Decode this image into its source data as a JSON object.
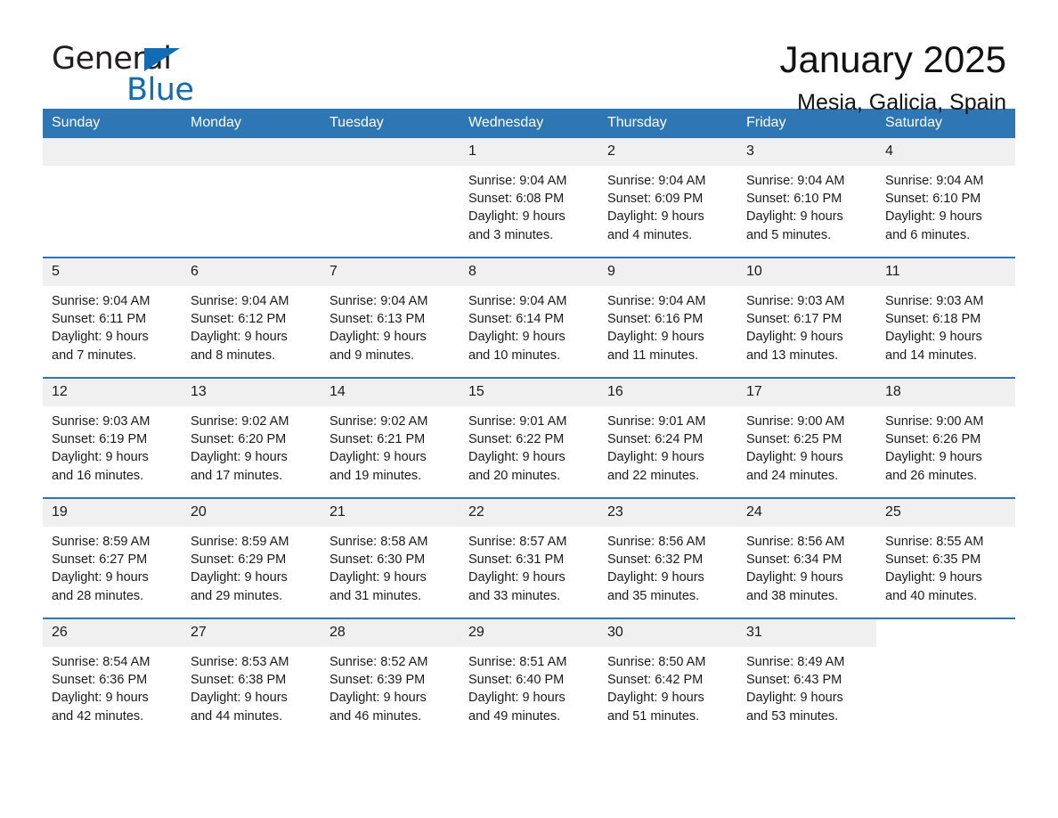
{
  "brand": {
    "name_part1": "General",
    "name_part2": "Blue",
    "triangle_color": "#0f6cb5"
  },
  "header": {
    "title": "January 2025",
    "subtitle": "Mesia, Galicia, Spain"
  },
  "colors": {
    "header_blue": "#2f76b4",
    "daynum_band": "#f0f0f0",
    "text": "#1a1a1a"
  },
  "weekday_headers": [
    "Sunday",
    "Monday",
    "Tuesday",
    "Wednesday",
    "Thursday",
    "Friday",
    "Saturday"
  ],
  "weeks": [
    [
      {
        "day": "",
        "empty": true
      },
      {
        "day": "",
        "empty": true
      },
      {
        "day": "",
        "empty": true
      },
      {
        "day": "1",
        "sunrise": "Sunrise: 9:04 AM",
        "sunset": "Sunset: 6:08 PM",
        "daylight1": "Daylight: 9 hours",
        "daylight2": "and 3 minutes."
      },
      {
        "day": "2",
        "sunrise": "Sunrise: 9:04 AM",
        "sunset": "Sunset: 6:09 PM",
        "daylight1": "Daylight: 9 hours",
        "daylight2": "and 4 minutes."
      },
      {
        "day": "3",
        "sunrise": "Sunrise: 9:04 AM",
        "sunset": "Sunset: 6:10 PM",
        "daylight1": "Daylight: 9 hours",
        "daylight2": "and 5 minutes."
      },
      {
        "day": "4",
        "sunrise": "Sunrise: 9:04 AM",
        "sunset": "Sunset: 6:10 PM",
        "daylight1": "Daylight: 9 hours",
        "daylight2": "and 6 minutes."
      }
    ],
    [
      {
        "day": "5",
        "sunrise": "Sunrise: 9:04 AM",
        "sunset": "Sunset: 6:11 PM",
        "daylight1": "Daylight: 9 hours",
        "daylight2": "and 7 minutes."
      },
      {
        "day": "6",
        "sunrise": "Sunrise: 9:04 AM",
        "sunset": "Sunset: 6:12 PM",
        "daylight1": "Daylight: 9 hours",
        "daylight2": "and 8 minutes."
      },
      {
        "day": "7",
        "sunrise": "Sunrise: 9:04 AM",
        "sunset": "Sunset: 6:13 PM",
        "daylight1": "Daylight: 9 hours",
        "daylight2": "and 9 minutes."
      },
      {
        "day": "8",
        "sunrise": "Sunrise: 9:04 AM",
        "sunset": "Sunset: 6:14 PM",
        "daylight1": "Daylight: 9 hours",
        "daylight2": "and 10 minutes."
      },
      {
        "day": "9",
        "sunrise": "Sunrise: 9:04 AM",
        "sunset": "Sunset: 6:16 PM",
        "daylight1": "Daylight: 9 hours",
        "daylight2": "and 11 minutes."
      },
      {
        "day": "10",
        "sunrise": "Sunrise: 9:03 AM",
        "sunset": "Sunset: 6:17 PM",
        "daylight1": "Daylight: 9 hours",
        "daylight2": "and 13 minutes."
      },
      {
        "day": "11",
        "sunrise": "Sunrise: 9:03 AM",
        "sunset": "Sunset: 6:18 PM",
        "daylight1": "Daylight: 9 hours",
        "daylight2": "and 14 minutes."
      }
    ],
    [
      {
        "day": "12",
        "sunrise": "Sunrise: 9:03 AM",
        "sunset": "Sunset: 6:19 PM",
        "daylight1": "Daylight: 9 hours",
        "daylight2": "and 16 minutes."
      },
      {
        "day": "13",
        "sunrise": "Sunrise: 9:02 AM",
        "sunset": "Sunset: 6:20 PM",
        "daylight1": "Daylight: 9 hours",
        "daylight2": "and 17 minutes."
      },
      {
        "day": "14",
        "sunrise": "Sunrise: 9:02 AM",
        "sunset": "Sunset: 6:21 PM",
        "daylight1": "Daylight: 9 hours",
        "daylight2": "and 19 minutes."
      },
      {
        "day": "15",
        "sunrise": "Sunrise: 9:01 AM",
        "sunset": "Sunset: 6:22 PM",
        "daylight1": "Daylight: 9 hours",
        "daylight2": "and 20 minutes."
      },
      {
        "day": "16",
        "sunrise": "Sunrise: 9:01 AM",
        "sunset": "Sunset: 6:24 PM",
        "daylight1": "Daylight: 9 hours",
        "daylight2": "and 22 minutes."
      },
      {
        "day": "17",
        "sunrise": "Sunrise: 9:00 AM",
        "sunset": "Sunset: 6:25 PM",
        "daylight1": "Daylight: 9 hours",
        "daylight2": "and 24 minutes."
      },
      {
        "day": "18",
        "sunrise": "Sunrise: 9:00 AM",
        "sunset": "Sunset: 6:26 PM",
        "daylight1": "Daylight: 9 hours",
        "daylight2": "and 26 minutes."
      }
    ],
    [
      {
        "day": "19",
        "sunrise": "Sunrise: 8:59 AM",
        "sunset": "Sunset: 6:27 PM",
        "daylight1": "Daylight: 9 hours",
        "daylight2": "and 28 minutes."
      },
      {
        "day": "20",
        "sunrise": "Sunrise: 8:59 AM",
        "sunset": "Sunset: 6:29 PM",
        "daylight1": "Daylight: 9 hours",
        "daylight2": "and 29 minutes."
      },
      {
        "day": "21",
        "sunrise": "Sunrise: 8:58 AM",
        "sunset": "Sunset: 6:30 PM",
        "daylight1": "Daylight: 9 hours",
        "daylight2": "and 31 minutes."
      },
      {
        "day": "22",
        "sunrise": "Sunrise: 8:57 AM",
        "sunset": "Sunset: 6:31 PM",
        "daylight1": "Daylight: 9 hours",
        "daylight2": "and 33 minutes."
      },
      {
        "day": "23",
        "sunrise": "Sunrise: 8:56 AM",
        "sunset": "Sunset: 6:32 PM",
        "daylight1": "Daylight: 9 hours",
        "daylight2": "and 35 minutes."
      },
      {
        "day": "24",
        "sunrise": "Sunrise: 8:56 AM",
        "sunset": "Sunset: 6:34 PM",
        "daylight1": "Daylight: 9 hours",
        "daylight2": "and 38 minutes."
      },
      {
        "day": "25",
        "sunrise": "Sunrise: 8:55 AM",
        "sunset": "Sunset: 6:35 PM",
        "daylight1": "Daylight: 9 hours",
        "daylight2": "and 40 minutes."
      }
    ],
    [
      {
        "day": "26",
        "sunrise": "Sunrise: 8:54 AM",
        "sunset": "Sunset: 6:36 PM",
        "daylight1": "Daylight: 9 hours",
        "daylight2": "and 42 minutes."
      },
      {
        "day": "27",
        "sunrise": "Sunrise: 8:53 AM",
        "sunset": "Sunset: 6:38 PM",
        "daylight1": "Daylight: 9 hours",
        "daylight2": "and 44 minutes."
      },
      {
        "day": "28",
        "sunrise": "Sunrise: 8:52 AM",
        "sunset": "Sunset: 6:39 PM",
        "daylight1": "Daylight: 9 hours",
        "daylight2": "and 46 minutes."
      },
      {
        "day": "29",
        "sunrise": "Sunrise: 8:51 AM",
        "sunset": "Sunset: 6:40 PM",
        "daylight1": "Daylight: 9 hours",
        "daylight2": "and 49 minutes."
      },
      {
        "day": "30",
        "sunrise": "Sunrise: 8:50 AM",
        "sunset": "Sunset: 6:42 PM",
        "daylight1": "Daylight: 9 hours",
        "daylight2": "and 51 minutes."
      },
      {
        "day": "31",
        "sunrise": "Sunrise: 8:49 AM",
        "sunset": "Sunset: 6:43 PM",
        "daylight1": "Daylight: 9 hours",
        "daylight2": "and 53 minutes."
      },
      {
        "day": "",
        "empty": true,
        "trailing": true
      }
    ]
  ]
}
